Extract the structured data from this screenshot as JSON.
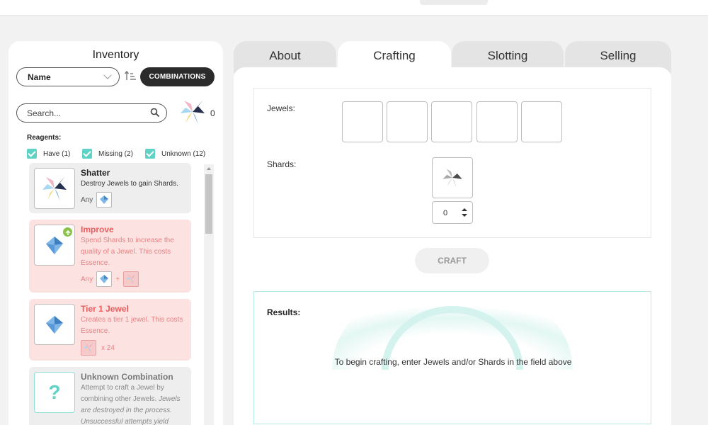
{
  "inventory": {
    "title": "Inventory",
    "sort_value": "Name",
    "combinations_label": "COMBINATIONS",
    "search_placeholder": "Search...",
    "shard_count": "0",
    "reagents_label": "Reagents:",
    "filters": [
      {
        "label": "Have (1)",
        "checked": true
      },
      {
        "label": "Missing (2)",
        "checked": true
      },
      {
        "label": "Unknown (12)",
        "checked": true
      }
    ],
    "recipes": [
      {
        "title": "Shatter",
        "desc": "Destroy Jewels to gain Shards.",
        "req_prefix": "Any",
        "status": "have"
      },
      {
        "title": "Improve",
        "desc": "Spend Shards to increase the quality of a Jewel. This costs Essence.",
        "req_prefix": "Any",
        "req_plus": "+",
        "status": "missing"
      },
      {
        "title": "Tier 1 Jewel",
        "desc": "Creates a tier 1 jewel. This costs Essence.",
        "req_qty": "x 24",
        "status": "missing"
      },
      {
        "title": "Unknown Combination",
        "desc_plain": "Attempt to craft a Jewel by combining other Jewels.",
        "desc_italic": "Jewels are destroyed in the process. Unsuccessful attempts yield",
        "status": "unknown",
        "icon_glyph": "?"
      }
    ]
  },
  "tabs": [
    {
      "label": "About",
      "active": false
    },
    {
      "label": "Crafting",
      "active": true
    },
    {
      "label": "Slotting",
      "active": false
    },
    {
      "label": "Selling",
      "active": false
    }
  ],
  "crafting": {
    "jewels_label": "Jewels:",
    "shards_label": "Shards:",
    "shard_quantity": "0",
    "craft_button": "CRAFT",
    "results_label": "Results:",
    "results_message": "To begin crafting, enter Jewels and/or Shards in the field above"
  },
  "colors": {
    "accent_teal": "#5ed2c4",
    "missing_bg": "#fde2e2",
    "missing_text": "#e85d5d",
    "dark_button": "#2b2b2b"
  },
  "icons": [
    "sort-icon",
    "search-icon",
    "shard-icon",
    "jewel-icon",
    "chevron-down-icon",
    "upgrade-badge-icon",
    "question-icon",
    "stepper-arrows-icon"
  ]
}
